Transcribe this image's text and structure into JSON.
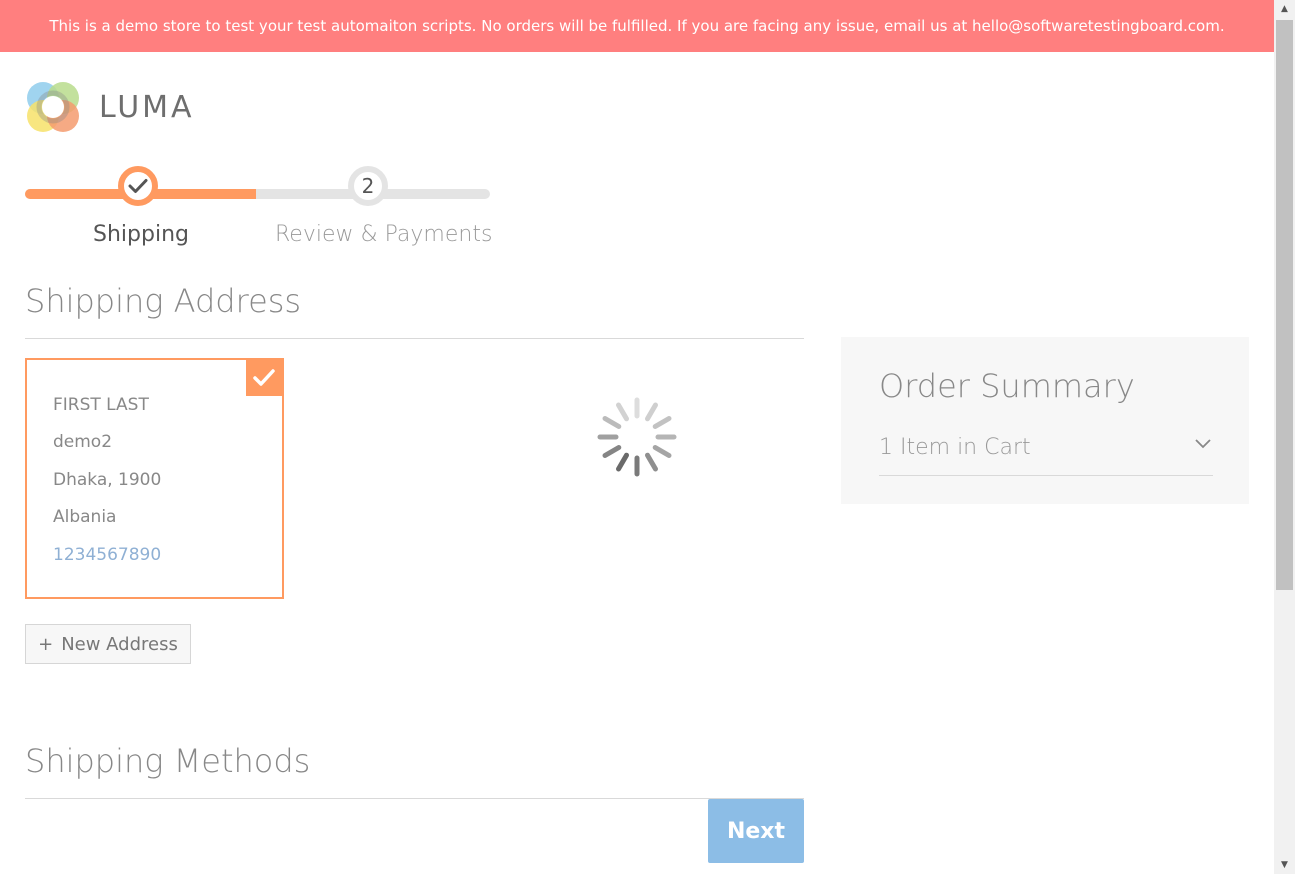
{
  "banner": {
    "text": "This is a demo store to test your test automaiton scripts. No orders will be fulfilled. If you are facing any issue, email us at hello@softwaretestingboard.com."
  },
  "logo": {
    "text": "LUMA"
  },
  "progress": {
    "steps": [
      {
        "number": "",
        "label": "Shipping",
        "status": "complete"
      },
      {
        "number": "2",
        "label": "Review & Payments",
        "status": "pending"
      }
    ]
  },
  "shipping_address": {
    "title": "Shipping Address",
    "card": {
      "name": "FIRST LAST",
      "street": "demo2",
      "city_zip": "Dhaka, 1900",
      "country": "Albania",
      "phone": "1234567890"
    },
    "new_address_label": "New Address",
    "new_address_icon": "+"
  },
  "shipping_methods": {
    "title": "Shipping Methods"
  },
  "next_button": {
    "label": "Next"
  },
  "order_summary": {
    "title": "Order Summary",
    "cart_label": "1 Item in Cart"
  },
  "colors": {
    "banner": "#ff7f7f",
    "accent": "#ff9a60",
    "next_button": "#8cbde6"
  }
}
